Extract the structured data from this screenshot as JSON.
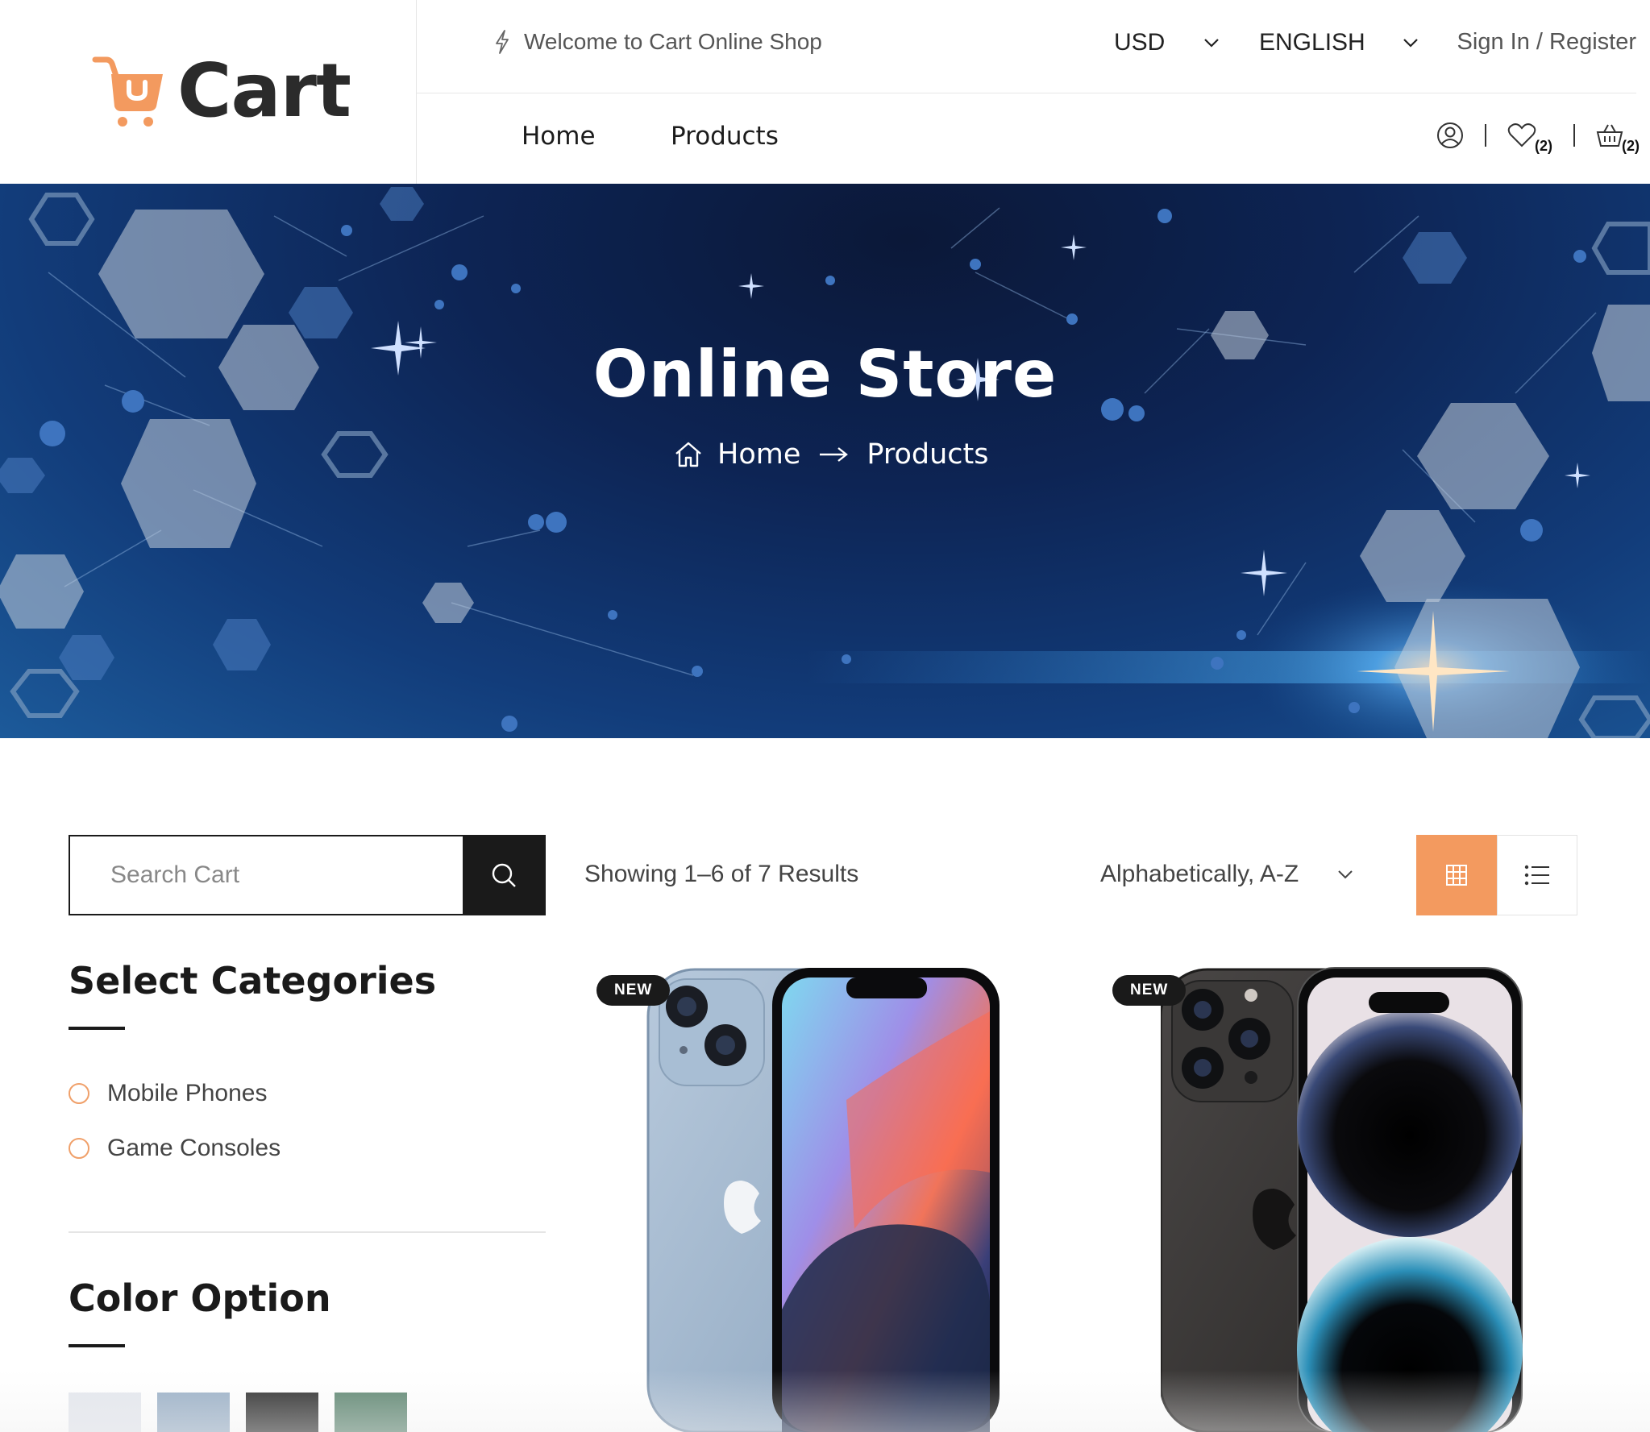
{
  "brand": {
    "name": "Cart",
    "accent": "#f39a5f"
  },
  "topbar": {
    "welcome": "Welcome to Cart Online Shop",
    "currency": "USD",
    "language": "ENGLISH",
    "signin": "Sign In / Register"
  },
  "nav": {
    "items": [
      {
        "label": "Home"
      },
      {
        "label": "Products"
      }
    ],
    "wishlist_count": "(2)",
    "cart_count": "(2)"
  },
  "banner": {
    "title": "Online Store",
    "breadcrumb": [
      "Home",
      "Products"
    ]
  },
  "sidebar": {
    "search_placeholder": "Search Cart",
    "categories_heading": "Select Categories",
    "categories": [
      {
        "label": "Mobile Phones"
      },
      {
        "label": "Game Consoles"
      }
    ],
    "color_heading": "Color Option",
    "colors": [
      "#e4e7ee",
      "#99afc6",
      "#2c2c2c",
      "#5d8570"
    ]
  },
  "toolbar": {
    "results": "Showing 1–6 of 7 Results",
    "sort": "Alphabetically, A-Z",
    "active_view": "grid"
  },
  "products": [
    {
      "badge": "NEW",
      "model": "blue-phone"
    },
    {
      "badge": "NEW",
      "model": "black-pro-phone"
    }
  ]
}
